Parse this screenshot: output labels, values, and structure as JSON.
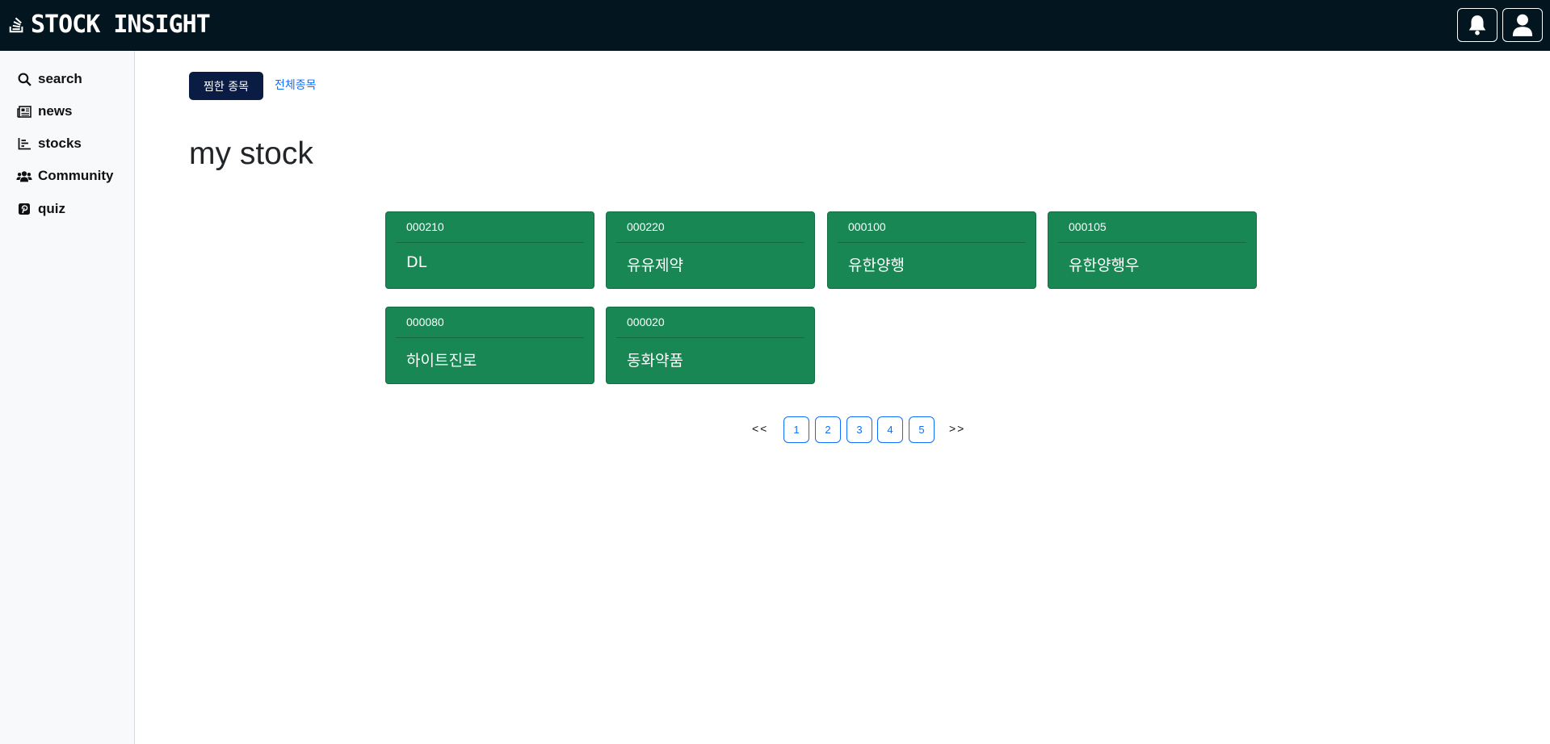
{
  "header": {
    "brand": "STOCK INSIGHT",
    "brand_icon": "stack-overflow-icon",
    "bell_icon": "bell-icon",
    "user_icon": "user-icon"
  },
  "sidebar": {
    "items": [
      {
        "label": "search",
        "icon": "search-icon"
      },
      {
        "label": "news",
        "icon": "newspaper-icon"
      },
      {
        "label": "stocks",
        "icon": "chart-icon"
      },
      {
        "label": "Community",
        "icon": "users-icon"
      },
      {
        "label": "quiz",
        "icon": "quiz-icon"
      }
    ]
  },
  "tabs": {
    "active": "찜한 종목",
    "other": "전체종목"
  },
  "main": {
    "title": "my stock",
    "cards": [
      {
        "code": "000210",
        "name": "DL"
      },
      {
        "code": "000220",
        "name": "유유제약"
      },
      {
        "code": "000100",
        "name": "유한양행"
      },
      {
        "code": "000105",
        "name": "유한양행우"
      },
      {
        "code": "000080",
        "name": "하이트진로"
      },
      {
        "code": "000020",
        "name": "동화약품"
      }
    ]
  },
  "pagination": {
    "prev": "<<",
    "next": ">>",
    "pages": [
      "1",
      "2",
      "3",
      "4",
      "5"
    ]
  },
  "colors": {
    "topbar": "#03161f",
    "card": "#198754",
    "active_tab": "#0b1c44",
    "link": "#0d6efd"
  }
}
